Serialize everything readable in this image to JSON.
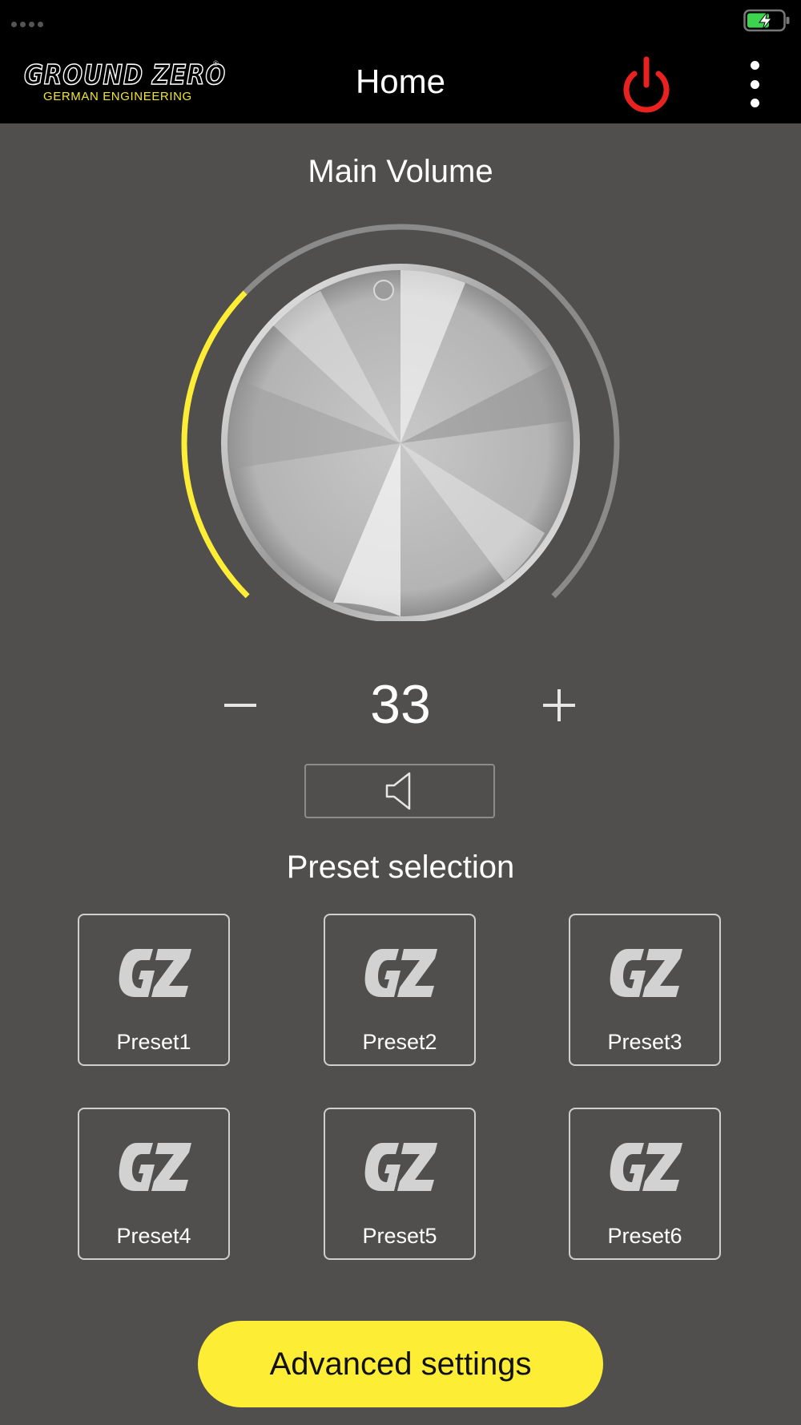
{
  "colors": {
    "background": "#504f4e",
    "topbar": "#000000",
    "accent_yellow": "#fdee35",
    "power_red": "#e8231f",
    "arc_inactive": "#8a8a8a"
  },
  "statusbar": {
    "battery_icon": "battery-charging-icon"
  },
  "header": {
    "logo_text": "GROUND ZERO",
    "logo_subtext": "GERMAN ENGINEERING",
    "logo_mark": "®",
    "title": "Home",
    "power_icon": "power-icon",
    "menu_icon": "more-vertical-icon"
  },
  "volume": {
    "title": "Main Volume",
    "value": "33",
    "level_fraction": 0.33,
    "minus_icon": "minus-icon",
    "plus_icon": "plus-icon",
    "mute_icon": "speaker-icon"
  },
  "presets": {
    "title": "Preset selection",
    "icon": "gz-logo-icon",
    "items": [
      {
        "label": "Preset1"
      },
      {
        "label": "Preset2"
      },
      {
        "label": "Preset3"
      },
      {
        "label": "Preset4"
      },
      {
        "label": "Preset5"
      },
      {
        "label": "Preset6"
      }
    ]
  },
  "footer": {
    "advanced_label": "Advanced settings"
  }
}
